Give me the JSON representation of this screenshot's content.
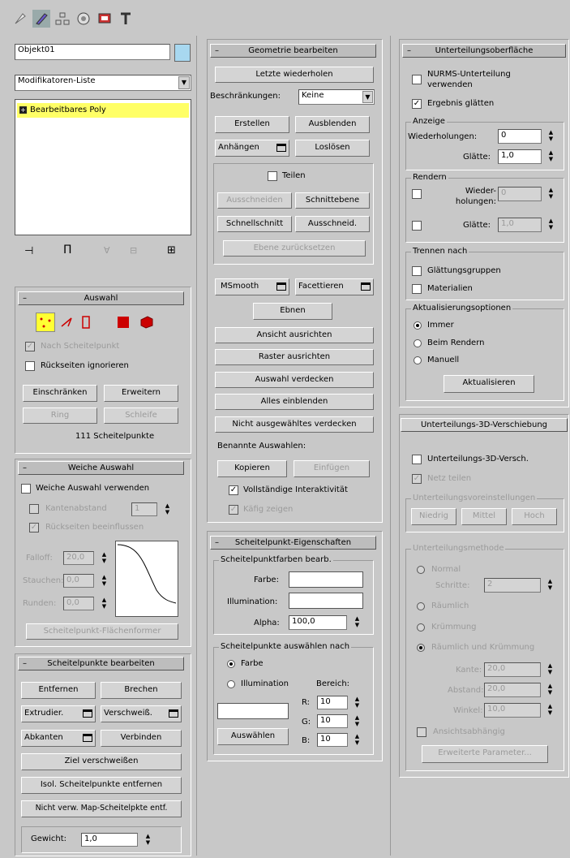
{
  "colors": {
    "accent": "#ffff66",
    "panel": "#c8c8c8",
    "field": "#ffffff"
  },
  "toolbar": {
    "icons": [
      "create-icon",
      "modify-icon",
      "hierarchy-icon",
      "motion-icon",
      "display-icon",
      "utilities-icon"
    ]
  },
  "object": {
    "name": "Objekt01",
    "color": "#a8d8f0"
  },
  "modifier_list": {
    "label": "Modifikatoren-Liste"
  },
  "stack": {
    "items": [
      {
        "label": "Bearbeitbares Poly"
      }
    ]
  },
  "stack_tools": {
    "icons": [
      "pin-icon",
      "show-end-icon",
      "unique-icon",
      "remove-icon",
      "configure-icon"
    ]
  },
  "auswahl": {
    "title": "Auswahl",
    "nach_scheitelpunkt": "Nach Scheitelpunkt",
    "rueckseiten": "Rückseiten ignorieren",
    "einschraenken": "Einschränken",
    "erweitern": "Erweitern",
    "ring": "Ring",
    "schleife": "Schleife",
    "info": "111 Scheitelpunkte"
  },
  "weiche": {
    "title": "Weiche Auswahl",
    "verwenden": "Weiche Auswahl verwenden",
    "kantenabstand": "Kantenabstand",
    "kantenabstand_val": "1",
    "rueckseiten": "Rückseiten beeinflussen",
    "falloff_label": "Falloff:",
    "falloff_val": "20,0",
    "stauchen_label": "Stauchen:",
    "stauchen_val": "0,0",
    "runden_label": "Runden:",
    "runden_val": "0,0",
    "button": "Scheitelpunkt-Flächenformer"
  },
  "sp_bearbeiten": {
    "title": "Scheitelpunkte bearbeiten",
    "entfernen": "Entfernen",
    "brechen": "Brechen",
    "extrudieren": "Extrudier.",
    "verschweissen": "Verschweiß.",
    "abkanten": "Abkanten",
    "verbinden": "Verbinden",
    "ziel": "Ziel verschweißen",
    "isol": "Isol. Scheitelpunkte entfernen",
    "nicht_verw": "Nicht verw. Map-Scheitelpkte entf.",
    "gewicht_label": "Gewicht:",
    "gewicht_val": "1,0"
  },
  "geometrie": {
    "title": "Geometrie bearbeiten",
    "letzte": "Letzte wiederholen",
    "beschraenkungen": "Beschränkungen:",
    "beschraenkungen_val": "Keine",
    "erstellen": "Erstellen",
    "ausblenden": "Ausblenden",
    "anhaengen": "Anhängen",
    "loesen": "Loslösen",
    "teilen": "Teilen",
    "ausschneiden": "Ausschneiden",
    "schnittebene": "Schnittebene",
    "schnellschnitt": "Schnellschnitt",
    "ausschneid": "Ausschneid.",
    "ebene_zuruecksetzen": "Ebene zurücksetzen",
    "msmooth": "MSmooth",
    "facettieren": "Facettieren",
    "ebnen": "Ebnen",
    "ansicht": "Ansicht ausrichten",
    "raster": "Raster ausrichten",
    "auswahl_verdecken": "Auswahl verdecken",
    "alles_einblenden": "Alles einblenden",
    "nicht_ausgewaehltes": "Nicht ausgewähltes verdecken",
    "benannte": "Benannte Auswahlen:",
    "kopieren": "Kopieren",
    "einfuegen": "Einfügen",
    "vollstaendig": "Vollständige Interaktivität",
    "kafig": "Käfig zeigen"
  },
  "sp_eigenschaften": {
    "title": "Scheitelpunkt-Eigenschaften",
    "farbe_bearb": "Scheitelpunktfarben bearb.",
    "farbe": "Farbe:",
    "illumination": "Illumination:",
    "alpha": "Alpha:",
    "alpha_val": "100,0",
    "auswaehlen_nach": "Scheitelpunkte auswählen nach",
    "r_farbe": "Farbe",
    "r_illumination": "Illumination",
    "bereich": "Bereich:",
    "r": "R:",
    "g": "G:",
    "b": "B:",
    "r_val": "10",
    "g_val": "10",
    "b_val": "10",
    "auswaehlen": "Auswählen"
  },
  "unterteilung": {
    "title": "Unterteilungsoberfläche",
    "nurms": "NURMS-Unterteilung verwenden",
    "glaetten": "Ergebnis glätten",
    "anzeige": "Anzeige",
    "wiederholungen": "Wiederholungen:",
    "wiederholungen_val": "0",
    "glaette": "Glätte:",
    "glaette_val": "1,0",
    "rendern": "Rendern",
    "r_wiederholungen": "Wieder-holungen:",
    "r_wiederholungen_val": "0",
    "r_glaette": "Glätte:",
    "r_glaette_val": "1,0",
    "trennen": "Trennen nach",
    "glaettungsgruppen": "Glättungsgruppen",
    "materialien": "Materialien",
    "aktualisierung": "Aktualisierungsoptionen",
    "immer": "Immer",
    "beim_rendern": "Beim Rendern",
    "manuell": "Manuell",
    "aktualisieren": "Aktualisieren"
  },
  "verschiebung": {
    "title": "Unterteilungs-3D-Verschiebung",
    "unterteilung_3d": "Unterteilungs-3D-Versch.",
    "netz": "Netz teilen",
    "voreinst": "Unterteilungsvoreinstellungen",
    "niedrig": "Niedrig",
    "mittel": "Mittel",
    "hoch": "Hoch",
    "methode": "Unterteilungsmethode",
    "normal": "Normal",
    "schritte": "Schritte:",
    "schritte_val": "2",
    "raeumlich": "Räumlich",
    "kruemmung": "Krümmung",
    "raeumlich_kruemmung": "Räumlich und Krümmung",
    "kante": "Kante:",
    "kante_val": "20,0",
    "abstand": "Abstand:",
    "abstand_val": "20,0",
    "winkel": "Winkel:",
    "winkel_val": "10,0",
    "ansichtsabh": "Ansichtsabhängig",
    "erweiterte": "Erweiterte Parameter..."
  }
}
